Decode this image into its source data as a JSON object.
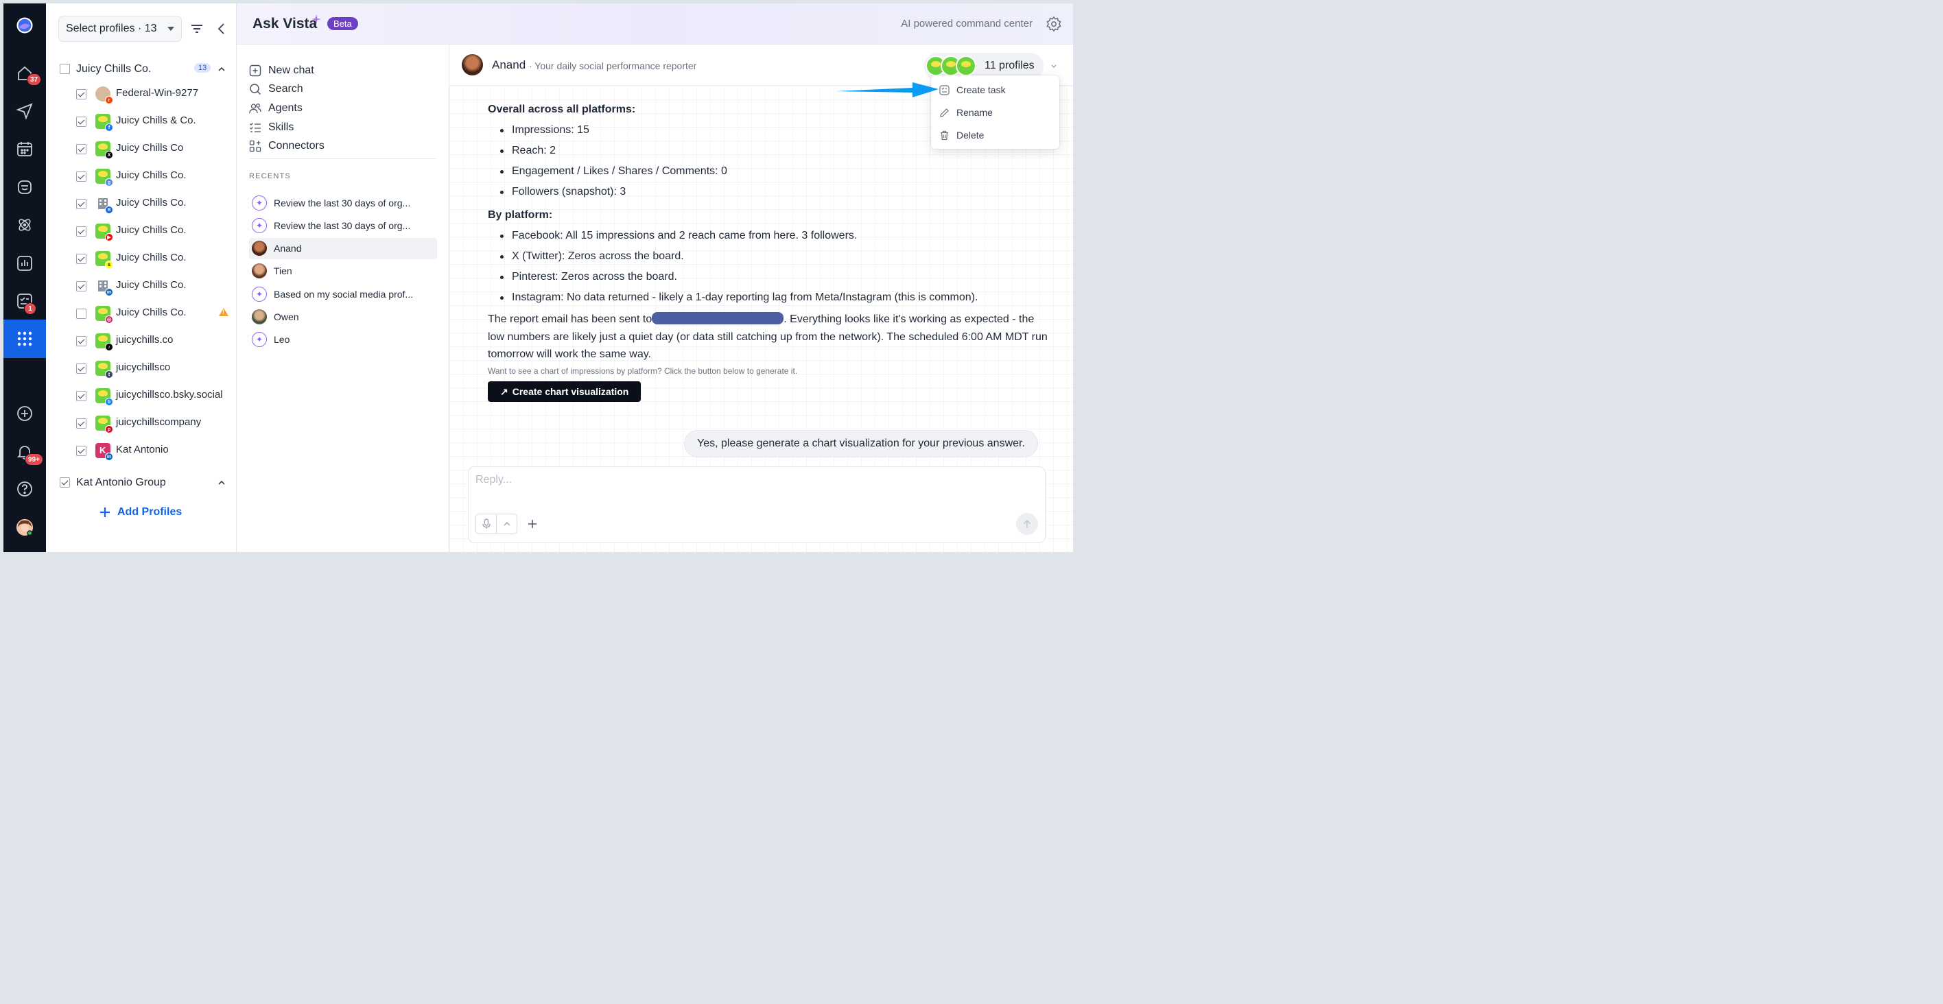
{
  "rail": {
    "home_badge": "37",
    "tasks_badge": "1",
    "notifications_badge": "99+"
  },
  "profiles": {
    "select_label": "Select profiles · 13",
    "group1": {
      "name": "Juicy Chills Co.",
      "count": "13"
    },
    "items": [
      {
        "label": "Federal-Win-9277",
        "network": "reddit",
        "checked": true
      },
      {
        "label": "Juicy Chills & Co.",
        "network": "facebook",
        "checked": true
      },
      {
        "label": "Juicy Chills Co",
        "network": "x",
        "checked": true
      },
      {
        "label": "Juicy Chills Co.",
        "network": "google-business",
        "checked": true
      },
      {
        "label": "Juicy Chills Co.",
        "network": "building",
        "checked": true
      },
      {
        "label": "Juicy Chills Co.",
        "network": "youtube",
        "checked": true
      },
      {
        "label": "Juicy Chills Co.",
        "network": "snapchat",
        "checked": true
      },
      {
        "label": "Juicy Chills Co.",
        "network": "linkedin-building",
        "checked": true
      },
      {
        "label": "Juicy Chills Co.",
        "network": "instagram",
        "checked": false
      },
      {
        "label": "juicychills.co",
        "network": "tiktok",
        "checked": true
      },
      {
        "label": "juicychillsco",
        "network": "tumblr",
        "checked": true
      },
      {
        "label": "juicychillsco.bsky.social",
        "network": "bluesky",
        "checked": true
      },
      {
        "label": "juicychillscompany",
        "network": "pinterest",
        "checked": true
      },
      {
        "label": "Kat Antonio",
        "network": "linkedin",
        "checked": true
      }
    ],
    "group2": {
      "name": "Kat Antonio Group"
    },
    "add_label": "Add Profiles"
  },
  "header": {
    "title": "Ask Vista",
    "beta": "Beta",
    "tagline": "AI powered command center"
  },
  "nav": {
    "new_chat": "New chat",
    "search": "Search",
    "agents": "Agents",
    "skills": "Skills",
    "connectors": "Connectors",
    "recents_label": "RECENTS",
    "recents": [
      {
        "label": "Review the last 30 days of org...",
        "type": "ai"
      },
      {
        "label": "Review the last 30 days of org...",
        "type": "ai"
      },
      {
        "label": "Anand",
        "type": "agent"
      },
      {
        "label": "Tien",
        "type": "agent"
      },
      {
        "label": "Based on my social media prof...",
        "type": "ai"
      },
      {
        "label": "Owen",
        "type": "agent"
      },
      {
        "label": "Leo",
        "type": "ai"
      }
    ]
  },
  "conversation": {
    "agent_name": "Anand",
    "agent_desc": "· Your daily social performance reporter",
    "profiles_count": "11 profiles",
    "overall_heading": "Overall across all platforms:",
    "overall": [
      "Impressions: 15",
      "Reach: 2",
      "Engagement / Likes / Shares / Comments: 0",
      "Followers (snapshot): 3"
    ],
    "platform_heading": "By platform:",
    "platforms": [
      "Facebook: All 15 impressions and 2 reach came from here. 3 followers.",
      "X (Twitter): Zeros across the board.",
      "Pinterest: Zeros across the board.",
      "Instagram: No data returned - likely a 1-day reporting lag from Meta/Instagram (this is common)."
    ],
    "report_prefix": "The report email has been sent to",
    "report_suffix": ". Everything looks like it's working as expected - the low numbers are likely just a quiet day (or data still catching up from the network). The scheduled 6:00 AM MDT run tomorrow will work the same way.",
    "hint": "Want to see a chart of impressions by platform? Click the button below to generate it.",
    "chart_button": "Create chart visualization",
    "user_message": "Yes, please generate a chart visualization for your previous answer.",
    "reply_placeholder": "Reply..."
  },
  "menu": {
    "create_task": "Create task",
    "rename": "Rename",
    "delete": "Delete"
  },
  "colors": {
    "accent": "#1463e6",
    "rail_bg": "#0e1320",
    "beta_bg": "#6c3fc5",
    "annotation_arrow": "#0a9bf2"
  }
}
